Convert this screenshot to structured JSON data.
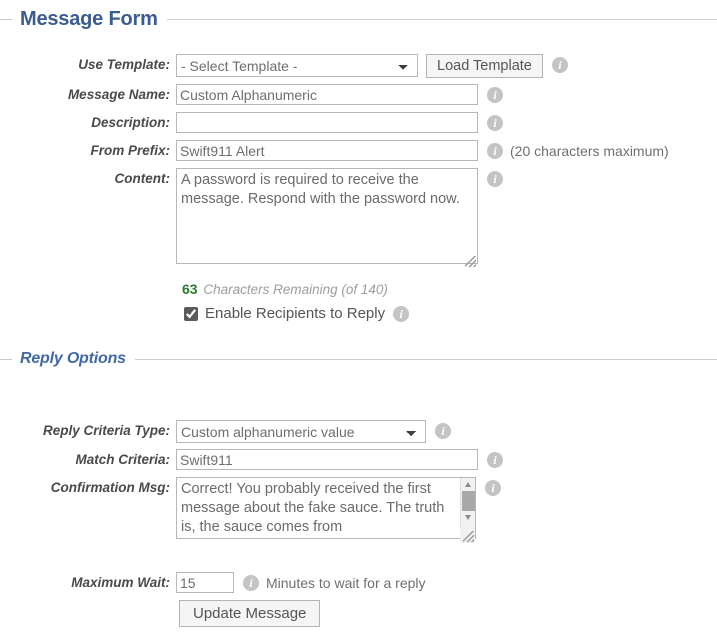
{
  "sections": {
    "message_form": {
      "title": "Message Form"
    },
    "reply_options": {
      "title": "Reply Options"
    }
  },
  "message_form": {
    "use_template": {
      "label": "Use Template:",
      "selected": "- Select Template -",
      "options": [
        "- Select Template -"
      ],
      "load_button": "Load Template",
      "info_icon": "info-icon"
    },
    "message_name": {
      "label": "Message Name:",
      "value": "Custom Alphanumeric",
      "placeholder": ""
    },
    "description": {
      "label": "Description:",
      "value": "",
      "placeholder": ""
    },
    "from_prefix": {
      "label": "From Prefix:",
      "value": "Swift911 Alert",
      "placeholder": "",
      "hint": "(20 characters maximum)"
    },
    "content": {
      "label": "Content:",
      "value": "A password is required to receive the message. Respond with the password now.",
      "placeholder": ""
    },
    "characters_remaining": {
      "count": "63",
      "label": "Characters Remaining (of 140)",
      "count_color": "#2c7a2c"
    },
    "enable_reply": {
      "label": "Enable Recipients to Reply",
      "checked": true
    }
  },
  "reply_options": {
    "reply_criteria_type": {
      "label": "Reply Criteria Type:",
      "selected": "Custom alphanumeric value",
      "options": [
        "Custom alphanumeric value"
      ]
    },
    "match_criteria": {
      "label": "Match Criteria:",
      "value": "Swift911",
      "placeholder": ""
    },
    "confirmation_msg": {
      "label": "Confirmation Msg:",
      "value": "Correct! You probably received the first message about the fake sauce. The truth is, the sauce comes from",
      "placeholder": ""
    },
    "maximum_wait": {
      "label": "Maximum Wait:",
      "value": "15",
      "placeholder": "",
      "hint": "Minutes to wait for a reply"
    }
  },
  "actions": {
    "update_message": "Update Message"
  },
  "icons": {
    "info": "i"
  },
  "colors": {
    "section_title": "#3a5c90",
    "subsection_title": "#4169a4",
    "label": "#4a4a4a",
    "field_text": "#6e6e6e",
    "rule": "#cfcfcf",
    "info_badge": "#c4c4c4",
    "chars_count": "#2c7a2c"
  }
}
